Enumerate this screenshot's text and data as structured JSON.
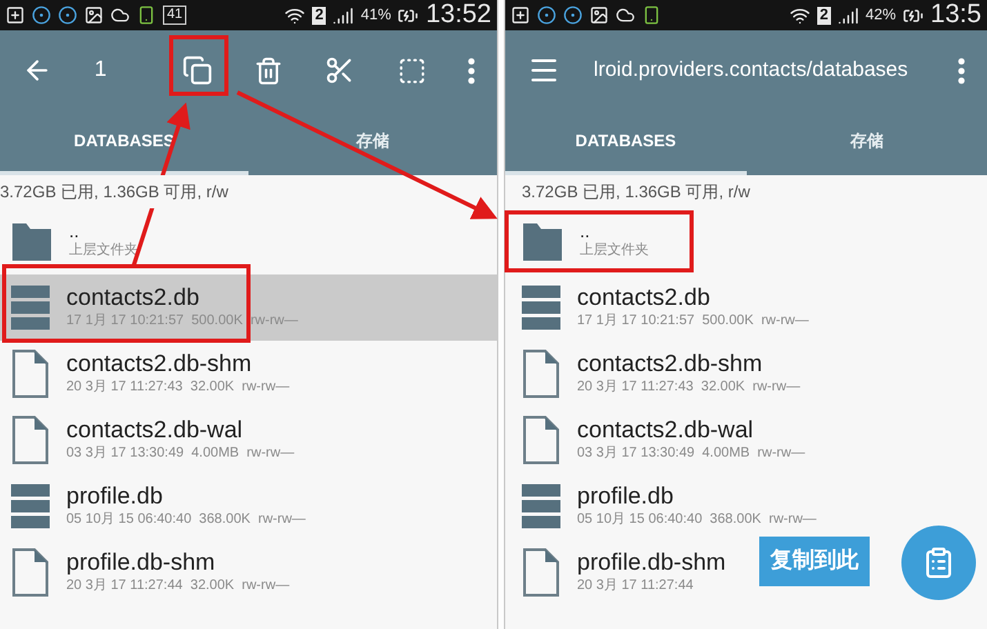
{
  "panels": [
    {
      "status_bar": {
        "badge": "41",
        "sim": "2",
        "battery": "41%",
        "time": "13:52"
      },
      "toolbar": {
        "kind": "selection",
        "count": "1"
      },
      "tabs": [
        {
          "label": "DATABASES",
          "selected": true
        },
        {
          "label": "存储",
          "selected": false
        }
      ],
      "storage_info": "3.72GB 已用, 1.36GB 可用, r/w",
      "files": [
        {
          "kind": "folder",
          "name": "..",
          "detail": "上层文件夹",
          "selected": false
        },
        {
          "kind": "db",
          "name": "contacts2.db",
          "detail": "17 1月 17 10:21:57  500.00K  rw-rw—",
          "selected": true
        },
        {
          "kind": "file",
          "name": "contacts2.db-shm",
          "detail": "20 3月 17 11:27:43  32.00K  rw-rw—",
          "selected": false
        },
        {
          "kind": "file",
          "name": "contacts2.db-wal",
          "detail": "03 3月 17 13:30:49  4.00MB  rw-rw—",
          "selected": false
        },
        {
          "kind": "db",
          "name": "profile.db",
          "detail": "05 10月 15 06:40:40  368.00K  rw-rw—",
          "selected": false
        },
        {
          "kind": "file",
          "name": "profile.db-shm",
          "detail": "20 3月 17 11:27:44  32.00K  rw-rw—",
          "selected": false
        }
      ]
    },
    {
      "status_bar": {
        "sim": "2",
        "battery": "42%",
        "time": "13:5"
      },
      "toolbar": {
        "kind": "browse",
        "title": "lroid.providers.contacts/databases"
      },
      "tabs": [
        {
          "label": "DATABASES",
          "selected": true
        },
        {
          "label": "存储",
          "selected": false
        }
      ],
      "storage_info": "3.72GB 已用, 1.36GB 可用, r/w",
      "files": [
        {
          "kind": "folder",
          "name": "..",
          "detail": "上层文件夹",
          "selected": false
        },
        {
          "kind": "db",
          "name": "contacts2.db",
          "detail": "17 1月 17 10:21:57  500.00K  rw-rw—",
          "selected": false
        },
        {
          "kind": "file",
          "name": "contacts2.db-shm",
          "detail": "20 3月 17 11:27:43  32.00K  rw-rw—",
          "selected": false
        },
        {
          "kind": "file",
          "name": "contacts2.db-wal",
          "detail": "03 3月 17 13:30:49  4.00MB  rw-rw—",
          "selected": false
        },
        {
          "kind": "db",
          "name": "profile.db",
          "detail": "05 10月 15 06:40:40  368.00K  rw-rw—",
          "selected": false
        },
        {
          "kind": "file",
          "name": "profile.db-shm",
          "detail": "20 3月 17 11:27:44",
          "selected": false
        }
      ],
      "paste_hint": "复制到此"
    }
  ]
}
